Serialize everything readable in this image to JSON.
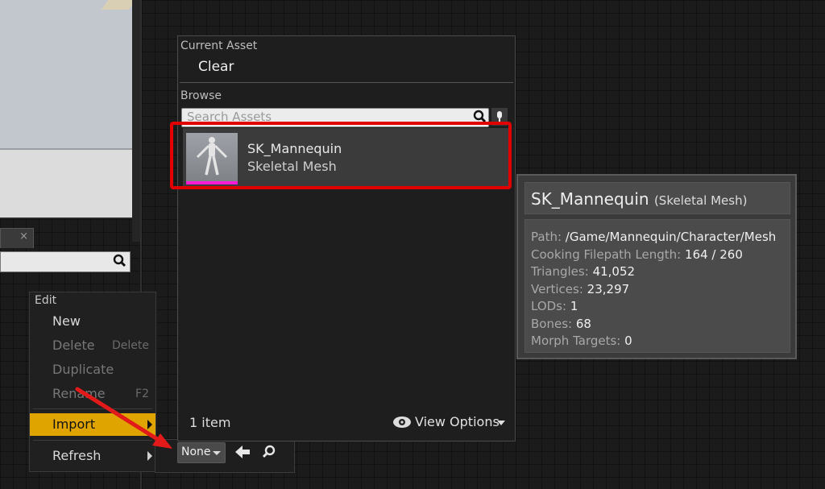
{
  "picker": {
    "current_asset_label": "Current Asset",
    "clear_label": "Clear",
    "browse_label": "Browse",
    "search_placeholder": "Search Assets",
    "item_count": "1 item",
    "view_options_label": "View Options"
  },
  "asset": {
    "name": "SK_Mannequin",
    "type": "Skeletal Mesh",
    "thumbnail_bar_color": "#ff1ad6"
  },
  "tooltip": {
    "name": "SK_Mannequin",
    "type": "(Skeletal Mesh)",
    "rows": [
      {
        "label": "Path:",
        "value": "/Game/Mannequin/Character/Mesh"
      },
      {
        "label": "Cooking Filepath Length:",
        "value": "164 / 260"
      },
      {
        "label": "Triangles:",
        "value": "41,052"
      },
      {
        "label": "Vertices:",
        "value": "23,297"
      },
      {
        "label": "LODs:",
        "value": "1"
      },
      {
        "label": "Bones:",
        "value": "68"
      },
      {
        "label": "Morph Targets:",
        "value": "0"
      }
    ]
  },
  "context_menu": {
    "header": "Edit",
    "items": [
      {
        "label": "New",
        "shortcut": ""
      },
      {
        "label": "Delete",
        "shortcut": "Delete"
      },
      {
        "label": "Duplicate",
        "shortcut": ""
      },
      {
        "label": "Rename",
        "shortcut": "F2"
      },
      {
        "label": "Import",
        "shortcut": ""
      },
      {
        "label": "Refresh",
        "shortcut": ""
      }
    ]
  },
  "bottom_bar": {
    "none_label": "None"
  },
  "colors": {
    "highlight_frame": "#e30000",
    "menu_active": "#e0a400"
  }
}
